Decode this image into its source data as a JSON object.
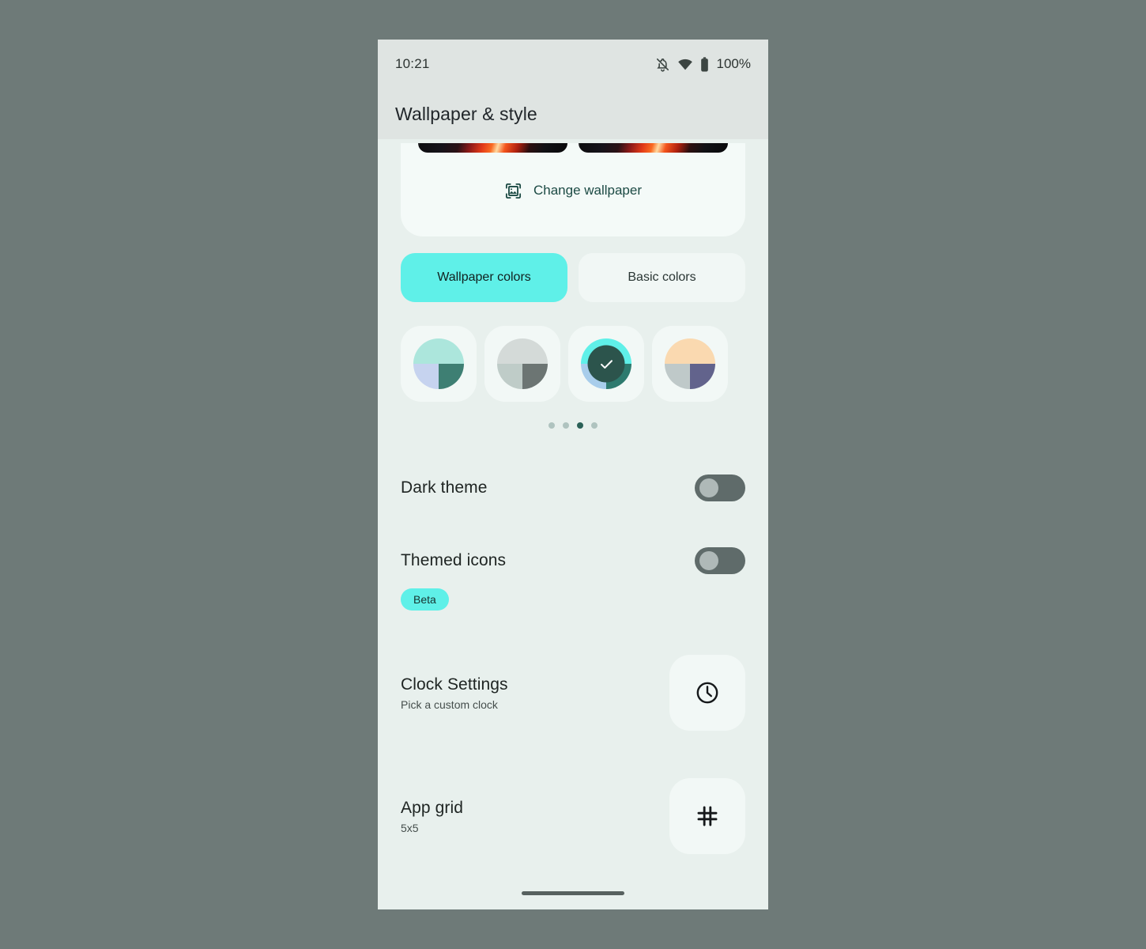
{
  "status_bar": {
    "time": "10:21",
    "battery_percent": "100%",
    "icons": [
      "notifications-off-icon",
      "wifi-icon",
      "battery-icon"
    ]
  },
  "app_bar": {
    "title": "Wallpaper & style"
  },
  "wallpaper_card": {
    "previews": [
      "wallpaper-preview-home",
      "wallpaper-preview-lock"
    ],
    "change_label": "Change wallpaper",
    "change_icon": "image-frame-icon",
    "accent_text_color": "#1C4A44"
  },
  "color_tabs": [
    {
      "label": "Wallpaper colors",
      "selected": true
    },
    {
      "label": "Basic colors",
      "selected": false
    }
  ],
  "color_swatches": [
    {
      "name": "swatch-1",
      "top": "#ACE6DC",
      "bottom_left": "#C6D3EF",
      "bottom_right": "#3E7F73",
      "selected": false
    },
    {
      "name": "swatch-2",
      "top": "#D4DAD8",
      "bottom_left": "#BFCCC8",
      "bottom_right": "#6C7573",
      "selected": false
    },
    {
      "name": "swatch-3",
      "top": "#5FF0E8",
      "bottom_left": "#A8CDEB",
      "bottom_right": "#2E7A6E",
      "selected": true
    },
    {
      "name": "swatch-4",
      "top": "#FAD9B0",
      "bottom_left": "#BFC9C9",
      "bottom_right": "#62638C",
      "selected": false
    }
  ],
  "pager": {
    "count": 4,
    "active_index": 2
  },
  "settings": {
    "dark_theme": {
      "title": "Dark theme",
      "toggle_on": false
    },
    "themed_icons": {
      "title": "Themed icons",
      "toggle_on": false,
      "badge": "Beta"
    },
    "clock_settings": {
      "title": "Clock Settings",
      "subtitle": "Pick a custom clock",
      "icon": "clock-icon"
    },
    "app_grid": {
      "title": "App grid",
      "subtitle": "5x5",
      "icon": "grid-hash-icon"
    }
  },
  "colors": {
    "surround": "#6E7A78",
    "phone_background": "#E8F0ED",
    "bar_background": "#DFE4E2",
    "card_background": "#F4FAF8",
    "accent": "#5FF0E8",
    "toggle_track_off": "#5F6B6A"
  }
}
